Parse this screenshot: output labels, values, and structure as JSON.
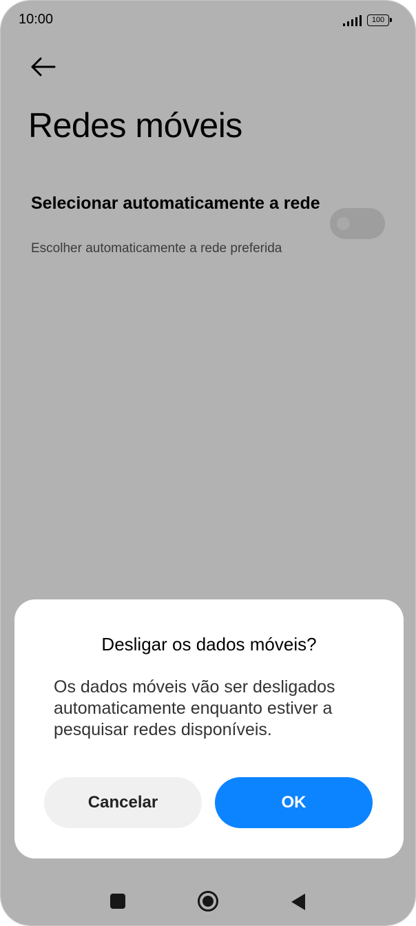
{
  "status_bar": {
    "time": "10:00",
    "battery_level": "100"
  },
  "header": {
    "title": "Redes móveis"
  },
  "settings": {
    "auto_network": {
      "title": "Selecionar automaticamente a rede",
      "subtitle": "Escolher automaticamente a rede preferida",
      "enabled": false
    }
  },
  "dialog": {
    "title": "Desligar os dados móveis?",
    "message": "Os dados móveis vão ser desligados automaticamente enquanto estiver a pesquisar redes disponíveis.",
    "cancel_label": "Cancelar",
    "ok_label": "OK"
  },
  "colors": {
    "accent": "#0d84ff",
    "scrim": "#b3b3b3"
  },
  "icons": [
    "back-arrow-icon",
    "signal-icon",
    "battery-icon",
    "recents-icon",
    "home-icon",
    "nav-back-icon"
  ]
}
